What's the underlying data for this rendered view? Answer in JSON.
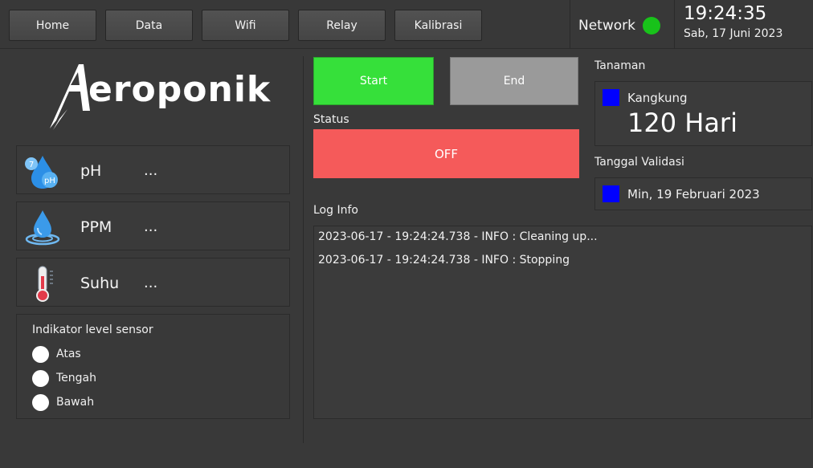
{
  "nav": {
    "items": [
      "Home",
      "Data",
      "Wifi",
      "Relay",
      "Kalibrasi"
    ]
  },
  "network": {
    "label": "Network",
    "status_color": "#18c21a"
  },
  "clock": {
    "time": "19:24:35",
    "date": "Sab, 17 Juni 2023"
  },
  "logo": {
    "text": "eroponik",
    "full_text": "Aeroponik"
  },
  "sensors": [
    {
      "name": "pH",
      "value": "...",
      "icon": "ph-drop-icon"
    },
    {
      "name": "PPM",
      "value": "...",
      "icon": "water-drop-icon"
    },
    {
      "name": "Suhu",
      "value": "...",
      "icon": "thermometer-icon"
    }
  ],
  "level_sensor": {
    "title": "Indikator level sensor",
    "levels": [
      "Atas",
      "Tengah",
      "Bawah"
    ]
  },
  "controls": {
    "start_label": "Start",
    "end_label": "End",
    "status_label": "Status",
    "status_value": "OFF"
  },
  "log": {
    "label": "Log Info",
    "lines": [
      "2023-06-17 - 19:24:24.738 - INFO : Cleaning up...",
      "2023-06-17 - 19:24:24.738 - INFO : Stopping"
    ]
  },
  "plant": {
    "label": "Tanaman",
    "name": "Kangkung",
    "days": "120 Hari"
  },
  "validation": {
    "label": "Tanggal Validasi",
    "date": "Min, 19 Februari 2023"
  }
}
